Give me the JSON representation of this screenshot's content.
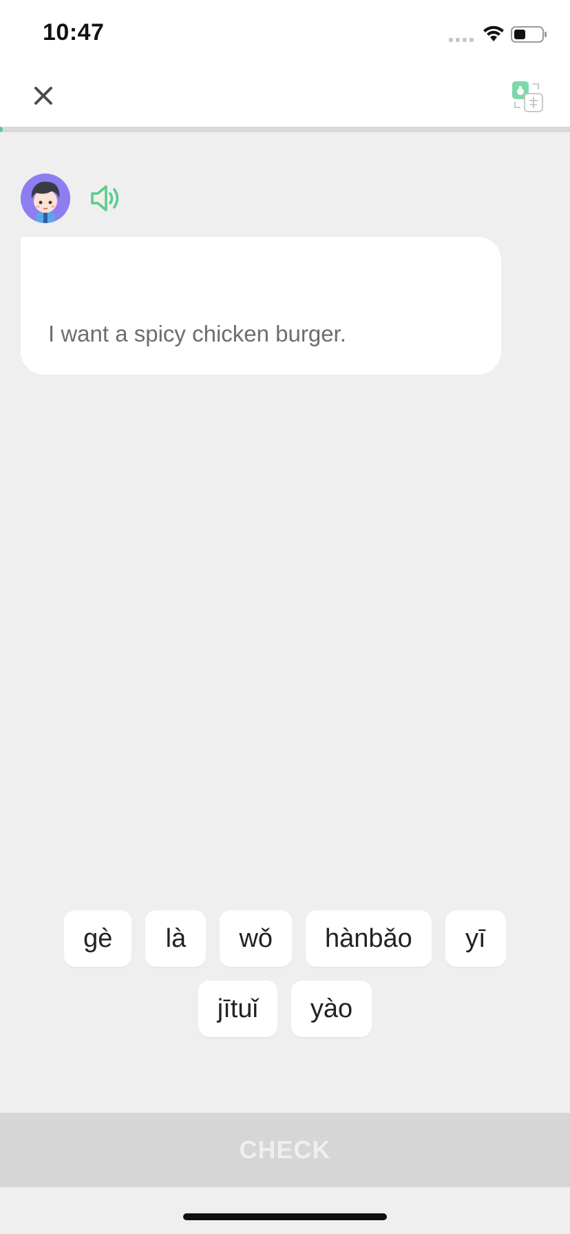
{
  "status_bar": {
    "time": "10:47",
    "icons": [
      "signal-icon",
      "wifi-icon",
      "battery-icon"
    ]
  },
  "top_nav": {
    "close_label": "X",
    "close_icon": "close-icon",
    "translate_icon": "translate-icon"
  },
  "progress": {
    "fraction": 0.004,
    "fill_color": "#58cc8a"
  },
  "prompt": {
    "avatar_icon": "boy-avatar",
    "sound_icon": "speaker-icon",
    "text": "I want a spicy chicken burger."
  },
  "word_bank": {
    "rows": [
      [
        "gè",
        "là",
        "wǒ",
        "hànbǎo",
        "yī"
      ],
      [
        "jītuǐ",
        "yào"
      ]
    ]
  },
  "check_button": {
    "label": "CHECK",
    "enabled": false
  },
  "colors": {
    "accent_green": "#58cc8a",
    "background": "#efefef",
    "disabled_button": "#d6d6d6"
  }
}
